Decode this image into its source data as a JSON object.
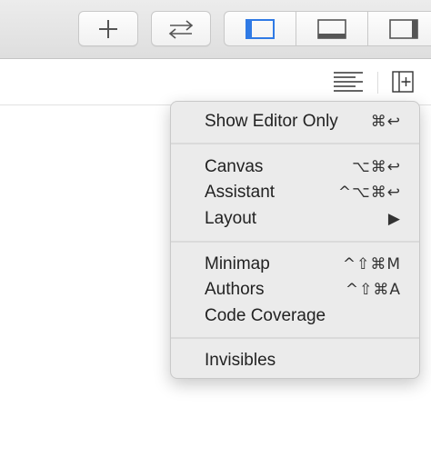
{
  "toolbar": {
    "add_icon": "plus-icon",
    "swap_icon": "swap-arrows-icon",
    "panels": [
      "left-panel-icon",
      "bottom-panel-icon",
      "right-panel-icon"
    ],
    "accent": "#2f7ae5"
  },
  "jumpbar": {
    "icons": [
      "lines-icon",
      "add-editor-icon"
    ]
  },
  "menu": {
    "items": [
      {
        "label": "Show Editor Only",
        "shortcut": "⌘↩"
      },
      {
        "label": "Canvas",
        "shortcut": "⌥⌘↩"
      },
      {
        "label": "Assistant",
        "shortcut": "^⌥⌘↩"
      },
      {
        "label": "Layout",
        "shortcut": "▶"
      },
      {
        "label": "Minimap",
        "shortcut": "^⇧⌘M"
      },
      {
        "label": "Authors",
        "shortcut": "^⇧⌘A"
      },
      {
        "label": "Code Coverage",
        "shortcut": ""
      },
      {
        "label": "Invisibles",
        "shortcut": ""
      }
    ]
  }
}
